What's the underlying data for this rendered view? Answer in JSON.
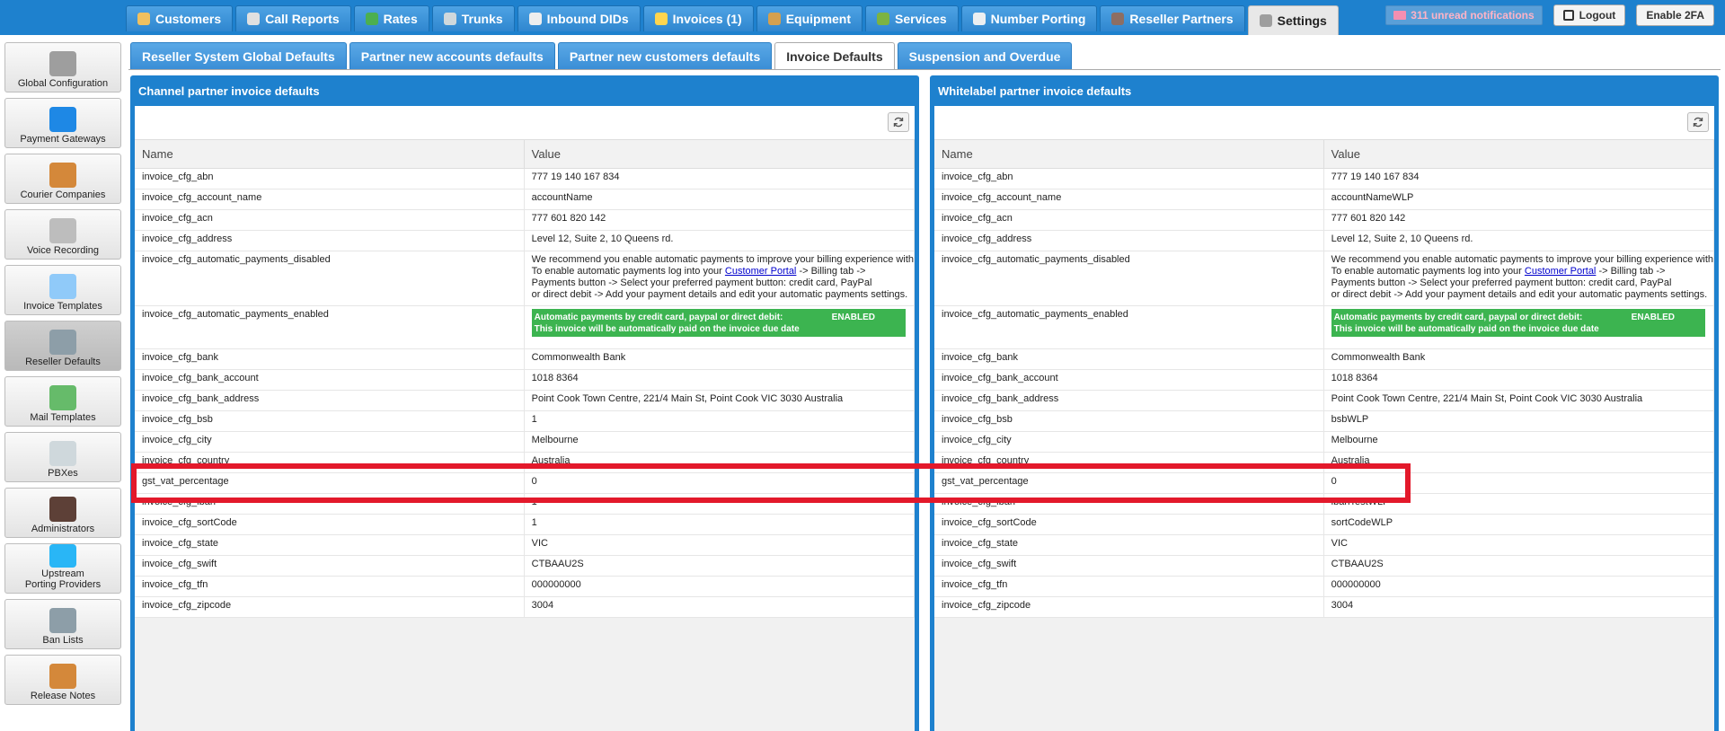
{
  "topnav": [
    {
      "label": "Customers",
      "icon": "customers-icon",
      "color": "#f0c060"
    },
    {
      "label": "Call Reports",
      "icon": "call-reports-icon",
      "color": "#e0e0e0"
    },
    {
      "label": "Rates",
      "icon": "rates-icon",
      "color": "#4caf50"
    },
    {
      "label": "Trunks",
      "icon": "trunks-icon",
      "color": "#cfd8dc"
    },
    {
      "label": "Inbound DIDs",
      "icon": "inbound-dids-icon",
      "color": "#eeeeee"
    },
    {
      "label": "Invoices (1)",
      "icon": "invoices-icon",
      "color": "#ffd54f"
    },
    {
      "label": "Equipment",
      "icon": "equipment-icon",
      "color": "#d4a04f"
    },
    {
      "label": "Services",
      "icon": "services-icon",
      "color": "#7cb342"
    },
    {
      "label": "Number Porting",
      "icon": "number-porting-icon",
      "color": "#eceff1"
    },
    {
      "label": "Reseller Partners",
      "icon": "reseller-partners-icon",
      "color": "#8d6e63"
    },
    {
      "label": "Settings",
      "icon": "settings-icon",
      "color": "#9e9e9e",
      "active": true
    }
  ],
  "topright": {
    "notifications": "311 unread notifications",
    "logout": "Logout",
    "enable2fa": "Enable 2FA"
  },
  "sidebar": [
    {
      "label": "Global Configuration",
      "icon": "gears-icon",
      "color": "#9e9e9e"
    },
    {
      "label": "Payment Gateways",
      "icon": "payment-gateway-icon",
      "color": "#1e88e5"
    },
    {
      "label": "Courier Companies",
      "icon": "courier-box-icon",
      "color": "#d4883a"
    },
    {
      "label": "Voice Recording",
      "icon": "megaphone-icon",
      "color": "#bdbdbd"
    },
    {
      "label": "Invoice Templates",
      "icon": "invoice-template-icon",
      "color": "#90caf9"
    },
    {
      "label": "Reseller Defaults",
      "icon": "reseller-defaults-icon",
      "color": "#8d9ea8",
      "active": true
    },
    {
      "label": "Mail Templates",
      "icon": "mail-icon",
      "color": "#66bb6a"
    },
    {
      "label": "PBXes",
      "icon": "pbx-icon",
      "color": "#cfd8dc"
    },
    {
      "label": "Administrators",
      "icon": "administrator-icon",
      "color": "#5d4037"
    },
    {
      "label": "Upstream Porting Providers",
      "line1": "Upstream",
      "line2": "Porting Providers",
      "icon": "upstream-porting-icon",
      "color": "#29b6f6"
    },
    {
      "label": "Ban Lists",
      "icon": "ban-list-icon",
      "color": "#8d9ea8"
    },
    {
      "label": "Release Notes",
      "icon": "release-notes-icon",
      "color": "#d4883a"
    }
  ],
  "subtabs": [
    {
      "label": "Reseller System Global Defaults"
    },
    {
      "label": "Partner new accounts defaults"
    },
    {
      "label": "Partner new customers defaults"
    },
    {
      "label": "Invoice Defaults",
      "active": true
    },
    {
      "label": "Suspension and Overdue"
    }
  ],
  "table_headers": {
    "name": "Name",
    "value": "Value"
  },
  "panels": [
    {
      "title": "Channel partner invoice defaults",
      "rows": [
        {
          "name": "invoice_cfg_abn",
          "value": "777 19 140 167 834"
        },
        {
          "name": "invoice_cfg_account_name",
          "value": "accountName"
        },
        {
          "name": "invoice_cfg_acn",
          "value": "777 601 820 142"
        },
        {
          "name": "invoice_cfg_address",
          "value": "Level 12, Suite 2, 10 Queens rd."
        },
        {
          "name": "invoice_cfg_automatic_payments_disabled",
          "type": "disabled_text"
        },
        {
          "name": "invoice_cfg_automatic_payments_enabled",
          "type": "enabled_box"
        },
        {
          "name": "invoice_cfg_bank",
          "value": "Commonwealth Bank"
        },
        {
          "name": "invoice_cfg_bank_account",
          "value": "1018 8364"
        },
        {
          "name": "invoice_cfg_bank_address",
          "value": "Point Cook Town Centre, 221/4 Main St, Point Cook VIC 3030 Australia"
        },
        {
          "name": "invoice_cfg_bsb",
          "value": "1"
        },
        {
          "name": "invoice_cfg_city",
          "value": "Melbourne"
        },
        {
          "name": "invoice_cfg_country",
          "value": "Australia",
          "clipped": true
        },
        {
          "name": "gst_vat_percentage",
          "value": "0"
        },
        {
          "name": "invoice_cfg_iban",
          "value": "1",
          "clipped": true
        },
        {
          "name": "invoice_cfg_sortCode",
          "value": "1"
        },
        {
          "name": "invoice_cfg_state",
          "value": "VIC"
        },
        {
          "name": "invoice_cfg_swift",
          "value": "CTBAAU2S"
        },
        {
          "name": "invoice_cfg_tfn",
          "value": "000000000"
        },
        {
          "name": "invoice_cfg_zipcode",
          "value": "3004"
        }
      ]
    },
    {
      "title": "Whitelabel partner invoice defaults",
      "rows": [
        {
          "name": "invoice_cfg_abn",
          "value": "777 19 140 167 834"
        },
        {
          "name": "invoice_cfg_account_name",
          "value": "accountNameWLP"
        },
        {
          "name": "invoice_cfg_acn",
          "value": "777 601 820 142"
        },
        {
          "name": "invoice_cfg_address",
          "value": "Level 12, Suite 2, 10 Queens rd."
        },
        {
          "name": "invoice_cfg_automatic_payments_disabled",
          "type": "disabled_text"
        },
        {
          "name": "invoice_cfg_automatic_payments_enabled",
          "type": "enabled_box"
        },
        {
          "name": "invoice_cfg_bank",
          "value": "Commonwealth Bank"
        },
        {
          "name": "invoice_cfg_bank_account",
          "value": "1018 8364"
        },
        {
          "name": "invoice_cfg_bank_address",
          "value": "Point Cook Town Centre, 221/4 Main St, Point Cook VIC 3030 Australia"
        },
        {
          "name": "invoice_cfg_bsb",
          "value": "bsbWLP"
        },
        {
          "name": "invoice_cfg_city",
          "value": "Melbourne"
        },
        {
          "name": "invoice_cfg_country",
          "value": "Australia",
          "clipped": true
        },
        {
          "name": "gst_vat_percentage",
          "value": "0"
        },
        {
          "name": "invoice_cfg_iban",
          "value": "ibanTestWLP",
          "clipped": true
        },
        {
          "name": "invoice_cfg_sortCode",
          "value": "sortCodeWLP"
        },
        {
          "name": "invoice_cfg_state",
          "value": "VIC"
        },
        {
          "name": "invoice_cfg_swift",
          "value": "CTBAAU2S"
        },
        {
          "name": "invoice_cfg_tfn",
          "value": "000000000"
        },
        {
          "name": "invoice_cfg_zipcode",
          "value": "3004"
        }
      ]
    }
  ],
  "disabled_text": {
    "line1": "We recommend you enable automatic payments to improve your billing experience with",
    "line2_pre": "To enable automatic payments log into your ",
    "link": "Customer Portal",
    "line2_post": " -> Billing tab ->",
    "line3": "Payments button -> Select your preferred payment button: credit card, PayPal",
    "line4": "or direct debit -> Add your payment details and edit your automatic payments settings."
  },
  "enabled_box": {
    "line1": "Automatic payments by credit card, paypal or direct debit:",
    "badge": "ENABLED",
    "line2": "This invoice will be automatically paid on the invoice due date"
  },
  "highlight_color": "#e3192b"
}
